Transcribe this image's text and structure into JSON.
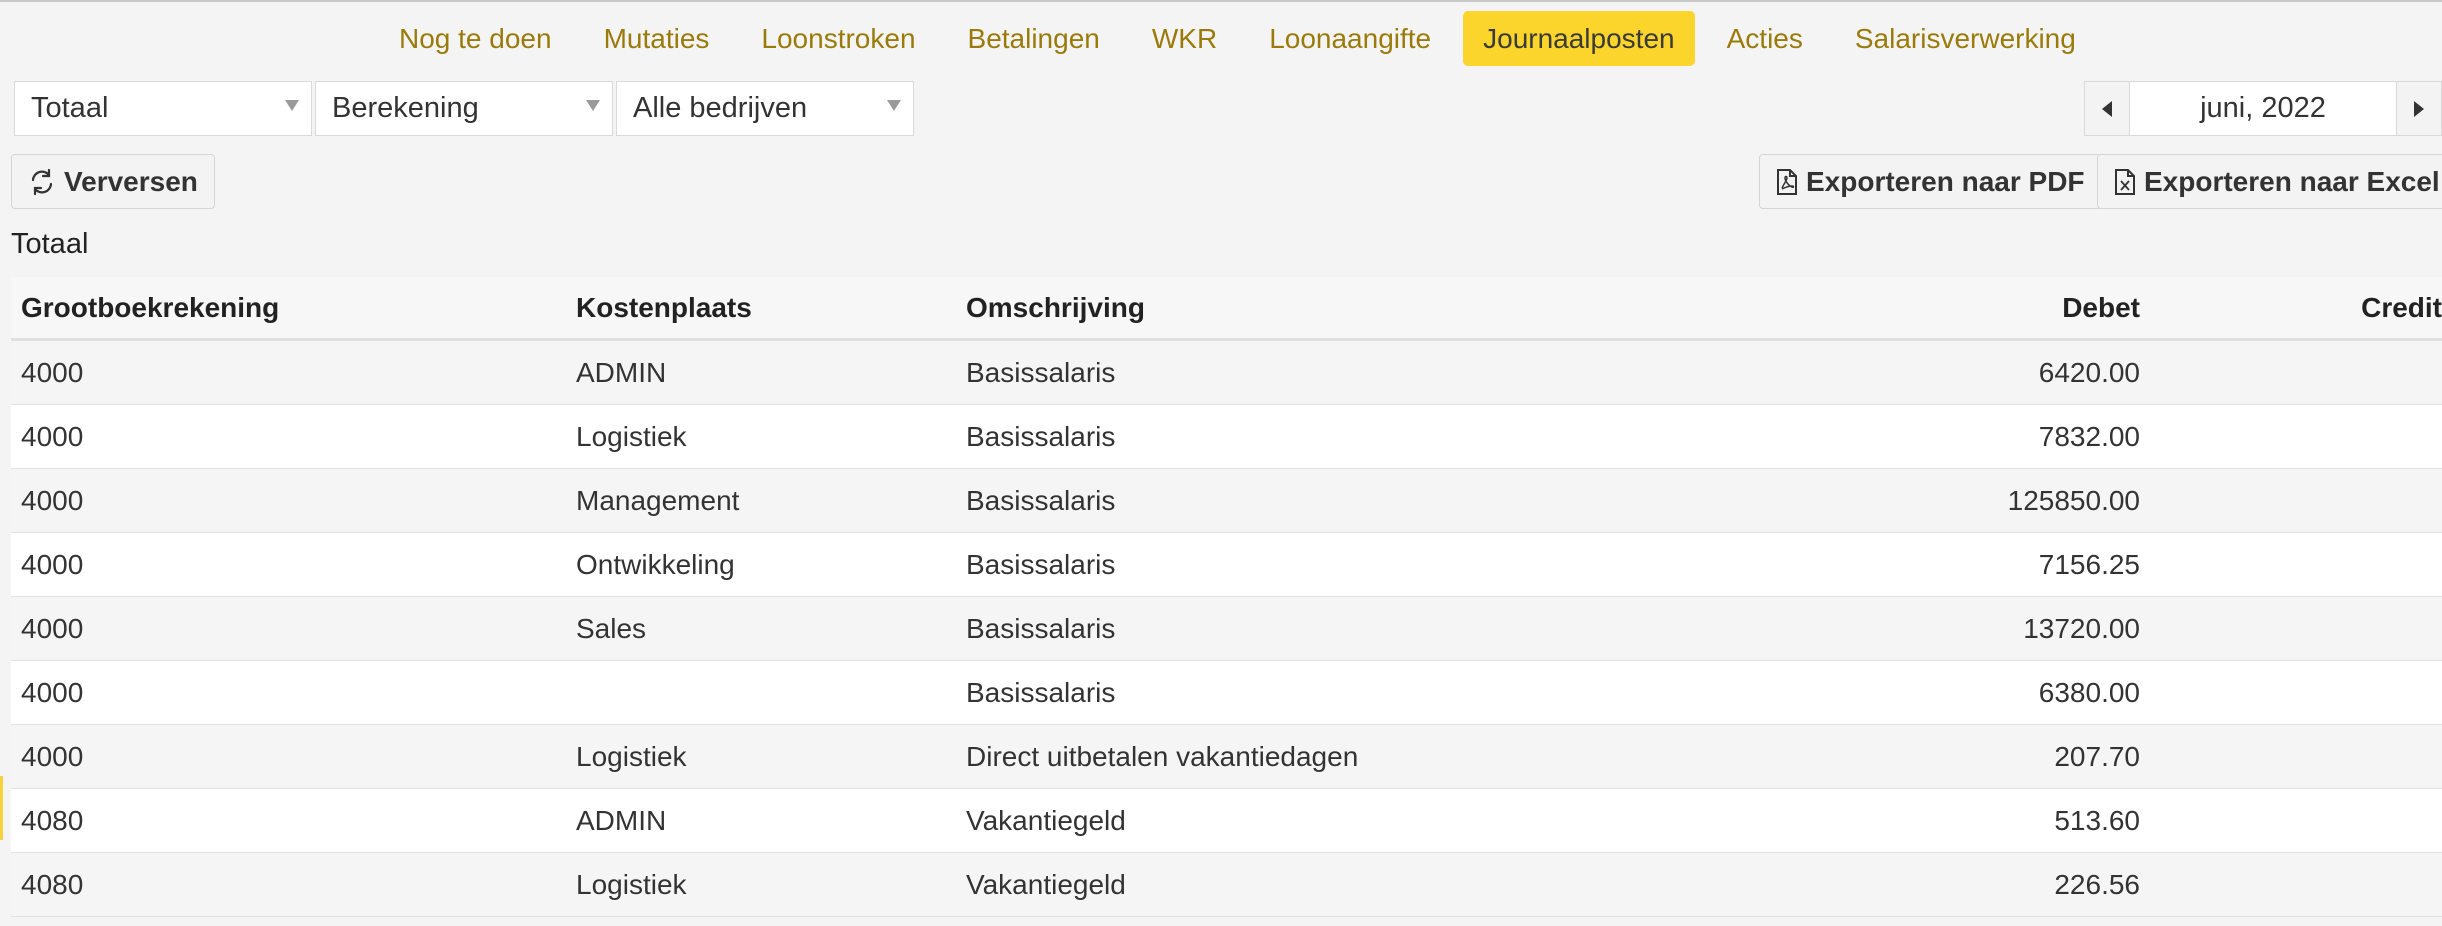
{
  "tabs": [
    {
      "label": "Nog te doen",
      "active": false
    },
    {
      "label": "Mutaties",
      "active": false
    },
    {
      "label": "Loonstroken",
      "active": false
    },
    {
      "label": "Betalingen",
      "active": false
    },
    {
      "label": "WKR",
      "active": false
    },
    {
      "label": "Loonaangifte",
      "active": false
    },
    {
      "label": "Journaalposten",
      "active": true
    },
    {
      "label": "Acties",
      "active": false
    },
    {
      "label": "Salarisverwerking",
      "active": false
    }
  ],
  "filters": {
    "type": "Totaal",
    "mode": "Berekening",
    "company": "Alle bedrijven"
  },
  "period": {
    "label": "juni, 2022"
  },
  "actions": {
    "refresh": "Verversen",
    "export_pdf": "Exporteren naar PDF",
    "export_excel": "Exporteren naar Excel"
  },
  "section_title": "Totaal",
  "table": {
    "headers": {
      "account": "Grootboekrekening",
      "cost_center": "Kostenplaats",
      "description": "Omschrijving",
      "debit": "Debet",
      "credit": "Credit"
    },
    "rows": [
      {
        "account": "4000",
        "cost_center": "ADMIN",
        "description": "Basissalaris",
        "debit": "6420.00",
        "credit": ""
      },
      {
        "account": "4000",
        "cost_center": "Logistiek",
        "description": "Basissalaris",
        "debit": "7832.00",
        "credit": ""
      },
      {
        "account": "4000",
        "cost_center": "Management",
        "description": "Basissalaris",
        "debit": "125850.00",
        "credit": ""
      },
      {
        "account": "4000",
        "cost_center": "Ontwikkeling",
        "description": "Basissalaris",
        "debit": "7156.25",
        "credit": ""
      },
      {
        "account": "4000",
        "cost_center": "Sales",
        "description": "Basissalaris",
        "debit": "13720.00",
        "credit": ""
      },
      {
        "account": "4000",
        "cost_center": "",
        "description": "Basissalaris",
        "debit": "6380.00",
        "credit": ""
      },
      {
        "account": "4000",
        "cost_center": "Logistiek",
        "description": "Direct uitbetalen vakantiedagen",
        "debit": "207.70",
        "credit": ""
      },
      {
        "account": "4080",
        "cost_center": "ADMIN",
        "description": "Vakantiegeld",
        "debit": "513.60",
        "credit": ""
      },
      {
        "account": "4080",
        "cost_center": "Logistiek",
        "description": "Vakantiegeld",
        "debit": "226.56",
        "credit": ""
      }
    ]
  },
  "colors": {
    "accent": "#fbd52c",
    "tab_text": "#9a7b0a",
    "background": "#f5f4f4"
  },
  "icons": {
    "refresh": "refresh-icon",
    "pdf": "file-pdf-icon",
    "excel": "file-excel-icon",
    "prev": "triangle-left-icon",
    "next": "triangle-right-icon",
    "dropdown": "caret-down-icon"
  }
}
